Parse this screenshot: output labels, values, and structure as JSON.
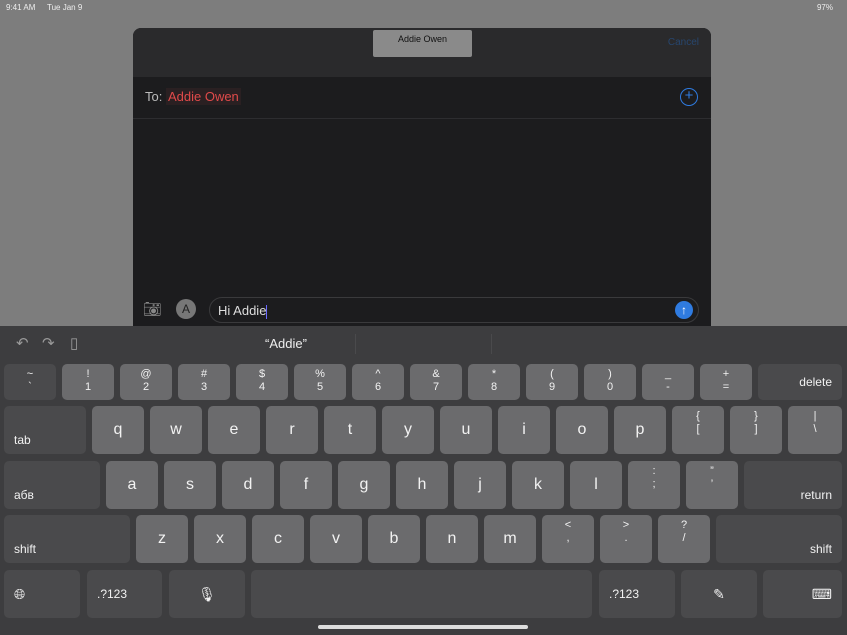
{
  "status": {
    "time": "9:41 AM",
    "date": "Tue Jan 9",
    "battery": "97%"
  },
  "sheet": {
    "title": "Addie Owen",
    "cancel": "Cancel",
    "to_label": "To:",
    "recipient": "Addie Owen",
    "message": "Hi Addie"
  },
  "keyboard": {
    "suggestion": "“Addie”",
    "rows": [
      [
        [
          "~",
          "`"
        ],
        [
          "!",
          "1"
        ],
        [
          "@",
          "2"
        ],
        [
          "#",
          "3"
        ],
        [
          "$",
          "4"
        ],
        [
          "%",
          "5"
        ],
        [
          "^",
          "6"
        ],
        [
          "&",
          "7"
        ],
        [
          "*",
          "8"
        ],
        [
          "(",
          "9"
        ],
        [
          ")",
          "0"
        ],
        [
          "_",
          "-"
        ],
        [
          "+",
          "="
        ],
        "delete"
      ],
      [
        "tab",
        "q",
        "w",
        "e",
        "r",
        "t",
        "y",
        "u",
        "i",
        "o",
        "p",
        [
          "{",
          "["
        ],
        [
          "}",
          "]"
        ],
        [
          "|",
          "\\"
        ]
      ],
      [
        "абв",
        "a",
        "s",
        "d",
        "f",
        "g",
        "h",
        "j",
        "k",
        "l",
        [
          ":",
          ";"
        ],
        [
          "”",
          "’"
        ],
        "return"
      ],
      [
        "shift",
        "z",
        "x",
        "c",
        "v",
        "b",
        "n",
        "m",
        [
          "<",
          ","
        ],
        [
          ">",
          "."
        ],
        [
          "?",
          "/"
        ],
        "shift"
      ],
      [
        "globe",
        ".?123",
        "mic",
        "",
        ".?123",
        "scribble",
        "keyboard-hide"
      ]
    ]
  }
}
